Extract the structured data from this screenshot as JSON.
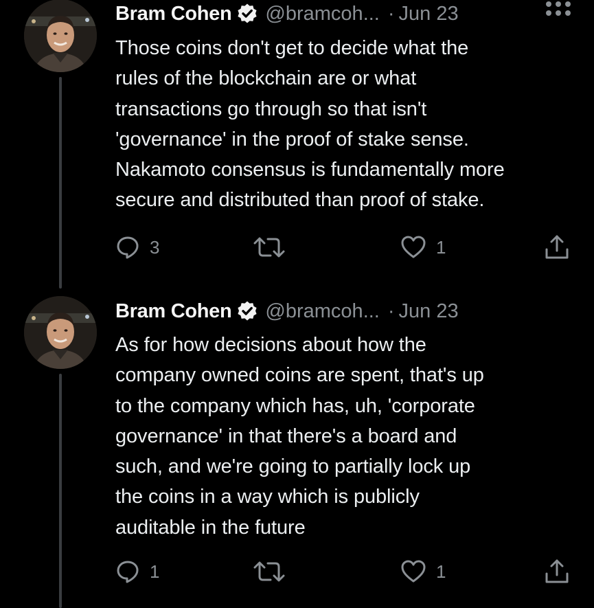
{
  "tweets": [
    {
      "author_name": "Bram Cohen",
      "handle": "@bramcoh...",
      "separator": "·",
      "date": "Jun 23",
      "text": "Those coins don't get to decide what the\nrules of the blockchain are or what\ntransactions go through so that isn't\n'governance' in the proof of stake sense.\nNakamoto consensus is fundamentally more\nsecure and distributed than proof of stake.",
      "reply_count": "3",
      "retweet_count": "",
      "like_count": "1",
      "icons": {
        "verified": "verified-badge-icon",
        "more": "more-options-icon",
        "reply": "reply-icon",
        "retweet": "retweet-icon",
        "like": "heart-icon",
        "share": "share-icon"
      }
    },
    {
      "author_name": "Bram Cohen",
      "handle": "@bramcoh...",
      "separator": "·",
      "date": "Jun 23",
      "text": "As for how decisions about how the\ncompany owned coins are spent, that's up\nto the company which has, uh, 'corporate\ngovernance' in that there's a board and\nsuch, and we're going to partially lock up\nthe coins in a way which is publicly\nauditable in the future",
      "reply_count": "1",
      "retweet_count": "",
      "like_count": "1",
      "icons": {
        "verified": "verified-badge-icon",
        "more": "more-options-icon",
        "reply": "reply-icon",
        "retweet": "retweet-icon",
        "like": "heart-icon",
        "share": "share-icon"
      }
    }
  ],
  "colors": {
    "background": "#000000",
    "text": "#eceff1",
    "secondary_text": "#8b9095",
    "thread_line": "#3a3d40"
  }
}
